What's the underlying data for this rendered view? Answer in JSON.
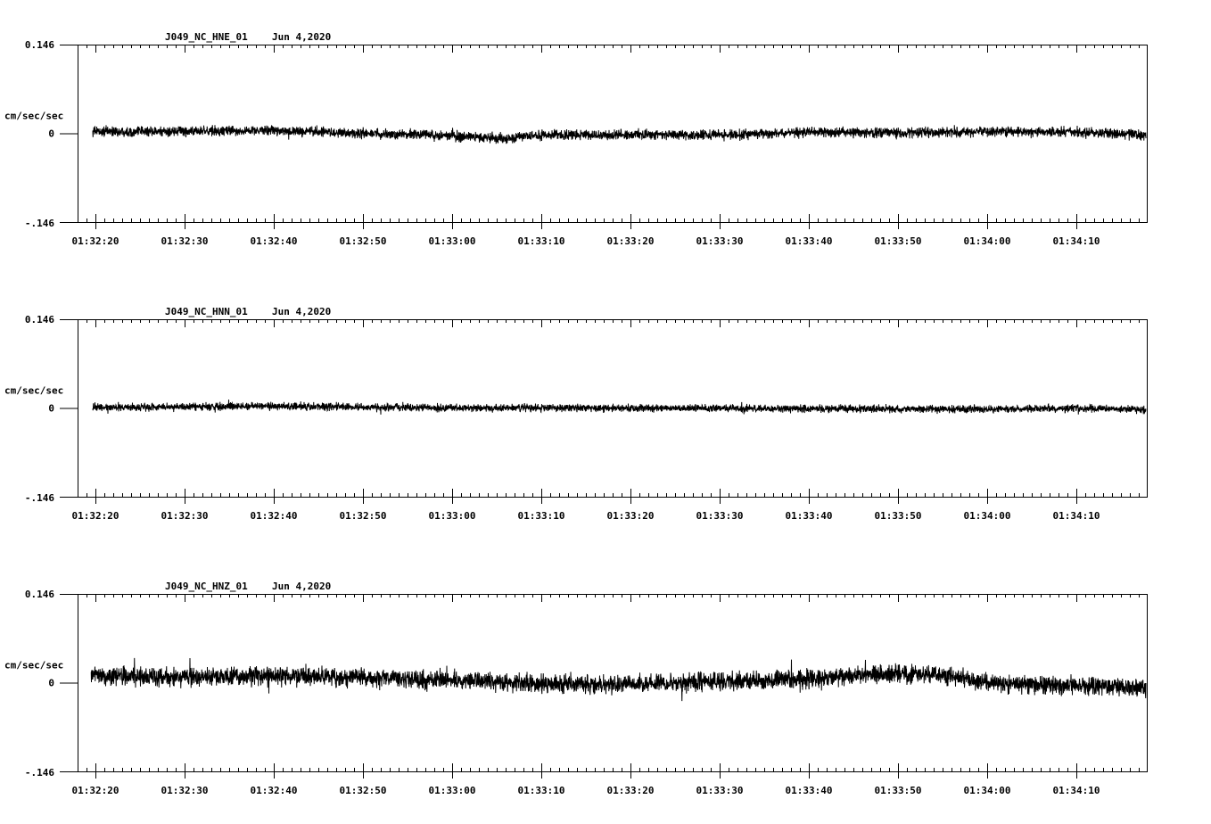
{
  "chart_data": [
    {
      "type": "line",
      "station": "J049_NC_HNE_01",
      "date": "Jun 4,2020",
      "ylabel": "cm/sec/sec",
      "ylim": [
        -0.146,
        0.146
      ],
      "y_tick_labels": [
        "0.146",
        "0",
        "-.146"
      ],
      "x_tick_labels": [
        "01:32:20",
        "01:32:30",
        "01:32:40",
        "01:32:50",
        "01:33:00",
        "01:33:10",
        "01:33:20",
        "01:33:30",
        "01:33:40",
        "01:33:50",
        "01:34:00",
        "01:34:10"
      ],
      "xlim_seconds": [
        -2,
        118
      ],
      "signal_start_seconds": -0.3,
      "noise_amplitude": 0.012,
      "drift": [
        [
          0,
          0.003
        ],
        [
          10,
          0.003
        ],
        [
          20,
          0.005
        ],
        [
          30,
          0.0
        ],
        [
          40,
          -0.004
        ],
        [
          45,
          -0.008
        ],
        [
          50,
          -0.003
        ],
        [
          60,
          -0.002
        ],
        [
          70,
          -0.003
        ],
        [
          80,
          0.002
        ],
        [
          90,
          0.001
        ],
        [
          100,
          0.003
        ],
        [
          110,
          0.002
        ],
        [
          118,
          -0.003
        ]
      ],
      "grid": false,
      "series": [
        {
          "values": []
        }
      ]
    },
    {
      "type": "line",
      "station": "J049_NC_HNN_01",
      "date": "Jun 4,2020",
      "ylabel": "cm/sec/sec",
      "ylim": [
        -0.146,
        0.146
      ],
      "y_tick_labels": [
        "0.146",
        "0",
        "-.146"
      ],
      "x_tick_labels": [
        "01:32:20",
        "01:32:30",
        "01:32:40",
        "01:32:50",
        "01:33:00",
        "01:33:10",
        "01:33:20",
        "01:33:30",
        "01:33:40",
        "01:33:50",
        "01:34:00",
        "01:34:10"
      ],
      "xlim_seconds": [
        -2,
        118
      ],
      "signal_start_seconds": -0.3,
      "noise_amplitude": 0.009,
      "drift": [
        [
          0,
          0.001
        ],
        [
          20,
          0.003
        ],
        [
          40,
          0.0
        ],
        [
          60,
          0.0
        ],
        [
          80,
          -0.001
        ],
        [
          100,
          -0.002
        ],
        [
          110,
          0.0
        ],
        [
          118,
          -0.003
        ]
      ],
      "grid": false,
      "series": [
        {
          "values": []
        }
      ]
    },
    {
      "type": "line",
      "station": "J049_NC_HNZ_01",
      "date": "Jun 4,2020",
      "ylabel": "cm/sec/sec",
      "ylim": [
        -0.146,
        0.146
      ],
      "y_tick_labels": [
        "0.146",
        "0",
        "-.146"
      ],
      "x_tick_labels": [
        "01:32:20",
        "01:32:30",
        "01:32:40",
        "01:32:50",
        "01:33:00",
        "01:33:10",
        "01:33:20",
        "01:33:30",
        "01:33:40",
        "01:33:50",
        "01:34:00",
        "01:34:10"
      ],
      "xlim_seconds": [
        -2,
        118
      ],
      "signal_start_seconds": -0.5,
      "noise_amplitude": 0.022,
      "drift": [
        [
          0,
          0.012
        ],
        [
          10,
          0.008
        ],
        [
          20,
          0.012
        ],
        [
          30,
          0.008
        ],
        [
          40,
          0.004
        ],
        [
          50,
          -0.002
        ],
        [
          60,
          -0.002
        ],
        [
          70,
          0.002
        ],
        [
          80,
          0.006
        ],
        [
          85,
          0.012
        ],
        [
          90,
          0.015
        ],
        [
          95,
          0.012
        ],
        [
          100,
          0.0
        ],
        [
          110,
          -0.005
        ],
        [
          118,
          -0.008
        ]
      ],
      "grid": false,
      "series": [
        {
          "values": []
        }
      ]
    }
  ]
}
